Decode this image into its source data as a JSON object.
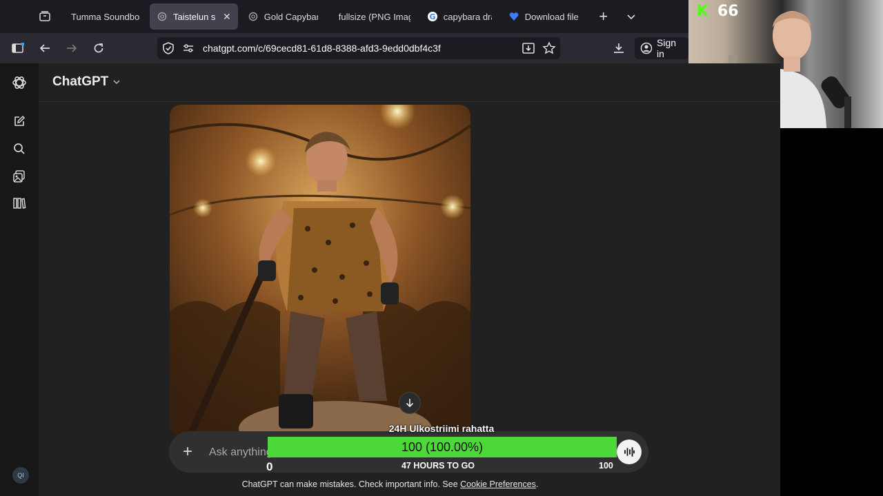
{
  "browser": {
    "tabs": [
      {
        "label": "Tumma Soundboard",
        "icon": "tab-favicon-soundboard",
        "active": false
      },
      {
        "label": "Taistelun sankari",
        "icon": "openai-logo-icon",
        "active": true
      },
      {
        "label": "Gold Capybara",
        "icon": "openai-logo-icon",
        "active": false
      },
      {
        "label": "fullsize (PNG Image)",
        "icon": "none",
        "active": false
      },
      {
        "label": "capybara drawing",
        "icon": "google-g-icon",
        "active": false
      },
      {
        "label": "Download file",
        "icon": "heart-icon",
        "active": false
      }
    ],
    "url": "chatgpt.com/c/69cecd81-61d8-8388-afd3-9edd0dbf4c3f",
    "sign_in_label": "Sign in"
  },
  "stream": {
    "kick_count": "66"
  },
  "chatgpt": {
    "model_label": "ChatGPT",
    "avatar_initials": "QI",
    "composer_placeholder": "Ask anything",
    "disclaimer_text": "ChatGPT can make mistakes. Check important info. See ",
    "disclaimer_link": "Cookie Preferences",
    "disclaimer_end": "."
  },
  "goal": {
    "title": "24H Ulkostriimi rahatta",
    "value_text": "100 (100.00%)",
    "progress": 1.0,
    "min": "0",
    "max": "100",
    "subtitle": "47 HOURS TO GO"
  },
  "colors": {
    "goal_fill": "#4cd838",
    "kick_green": "#53fc18"
  }
}
